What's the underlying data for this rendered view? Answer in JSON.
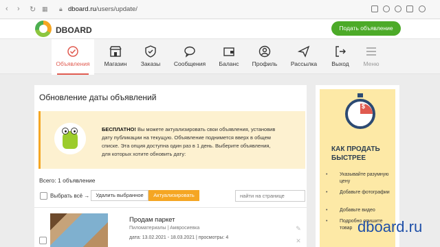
{
  "browser": {
    "url_host": "dboard.ru",
    "url_path": "/users/update/",
    "back_icon": "back-arrow-icon",
    "forward_icon": "forward-arrow-icon"
  },
  "header": {
    "brand": "DBOARD",
    "post_button": "Подать объявление"
  },
  "nav": [
    {
      "label": "Объявления",
      "icon": "check-circle-icon",
      "active": true
    },
    {
      "label": "Магазин",
      "icon": "store-icon"
    },
    {
      "label": "Заказы",
      "icon": "shield-icon"
    },
    {
      "label": "Сообщения",
      "icon": "chat-icon"
    },
    {
      "label": "Баланс",
      "icon": "wallet-icon"
    },
    {
      "label": "Профиль",
      "icon": "user-icon"
    },
    {
      "label": "Рассылка",
      "icon": "paper-plane-icon"
    },
    {
      "label": "Выход",
      "icon": "logout-icon"
    },
    {
      "label": "Меню",
      "icon": "menu-icon"
    }
  ],
  "main": {
    "title": "Обновление даты объявлений",
    "promo": {
      "bold": "БЕСПЛАТНО!",
      "text": "Вы можете актуализировать свои объявления, установив дату публикации на текущую. Объявление поднимется вверх в общем списке. Эта опция доступна один раз в 1 день. Выберите объявления, для которых хотите обновить дату:"
    },
    "total": "Всего: 1 объявление",
    "select_all": "Выбрать всё →",
    "delete_selected": "Удалить выбранное",
    "update_button": "Актуализировать",
    "search_placeholder": "найти на странице",
    "listing": {
      "title": "Продам паркет",
      "category": "Пиломатериалы | Амвросиевка",
      "dates": "дата: 13.02.2021 - 18.03.2021 | просмотры: 4"
    }
  },
  "sidebar": {
    "title": "КАК ПРОДАТЬ БЫСТРЕЕ",
    "tips": [
      "Указывайте разумную цену",
      "Добавьте фотографии",
      "Добавьте видео",
      "Подробно опишите товар"
    ]
  },
  "watermark": "dboard.ru",
  "colors": {
    "accent": "#e05a4f",
    "green": "#4caa28",
    "orange": "#f5a623"
  }
}
